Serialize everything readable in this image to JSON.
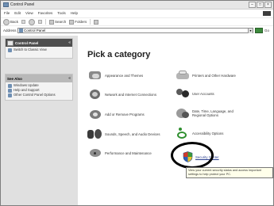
{
  "window": {
    "title": "Control Panel"
  },
  "menu": [
    "File",
    "Edit",
    "View",
    "Favorites",
    "Tools",
    "Help"
  ],
  "toolbar": {
    "back_label": "Back",
    "search_label": "Search",
    "folders_label": "Folders"
  },
  "address": {
    "label": "Address",
    "value": "Control Panel",
    "go_label": "Go"
  },
  "left_panels": {
    "control_panel": {
      "title": "Control Panel",
      "link": "Switch to Classic View"
    },
    "see_also": {
      "title": "See Also",
      "links": [
        "Windows Update",
        "Help and Support",
        "Other Control Panel Options"
      ]
    }
  },
  "main": {
    "title": "Pick a category",
    "categories": [
      {
        "label": "Appearance and Themes",
        "icon": "appearance-icon"
      },
      {
        "label": "Printers and Other Hardware",
        "icon": "printer-icon"
      },
      {
        "label": "Network and Internet Connections",
        "icon": "network-icon"
      },
      {
        "label": "User Accounts",
        "icon": "users-icon"
      },
      {
        "label": "Add or Remove Programs",
        "icon": "programs-icon"
      },
      {
        "label": "Date, Time, Language, and Regional Options",
        "icon": "clock-icon"
      },
      {
        "label": "Sounds, Speech, and Audio Devices",
        "icon": "speaker-icon"
      },
      {
        "label": "Accessibility Options",
        "icon": "accessibility-icon"
      },
      {
        "label": "Performance and Maintenance",
        "icon": "performance-icon"
      },
      {
        "label": "Security Center",
        "icon": "shield-icon"
      }
    ],
    "tooltip": "View your current security status and access important settings to help protect your PC."
  },
  "colors": {
    "highlight_ring": "#000000",
    "shield_red": "#d23a2a",
    "shield_green": "#3b9a3b",
    "shield_blue": "#2f5fb8",
    "shield_yellow": "#e8c32a"
  }
}
